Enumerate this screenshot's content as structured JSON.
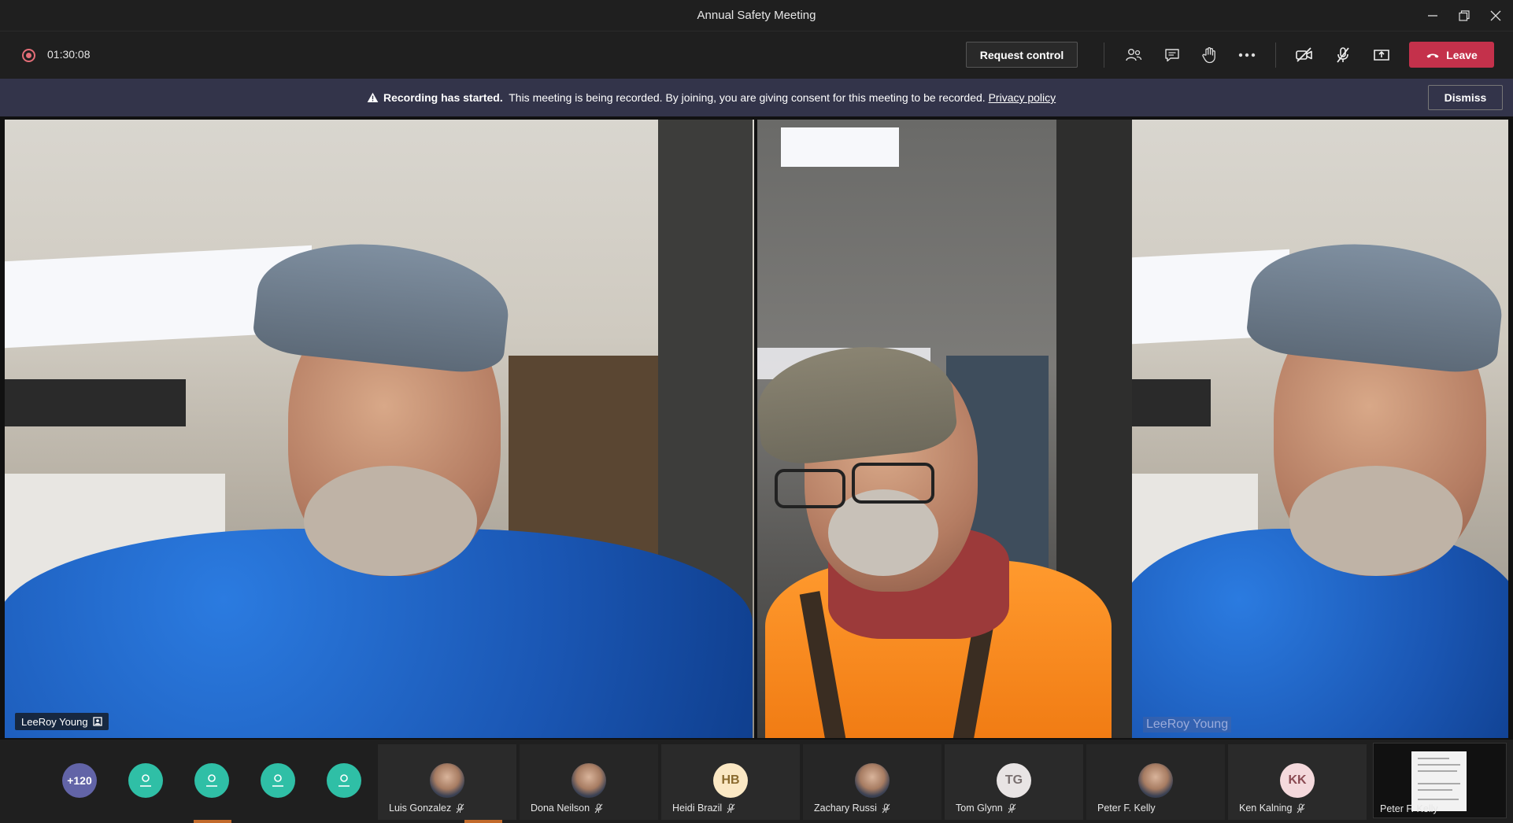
{
  "window": {
    "title": "Annual Safety Meeting",
    "minimize_icon": "minimize-icon",
    "restore_icon": "restore-icon",
    "close_icon": "close-icon"
  },
  "toolbar": {
    "recording_icon": "recording-dot-icon",
    "elapsed_time": "01:30:08",
    "request_control_label": "Request control",
    "icons": [
      "people-icon",
      "chat-icon",
      "raise-hand-icon",
      "more-options-icon",
      "camera-off-icon",
      "mic-off-icon",
      "share-screen-icon"
    ],
    "leave_label": "Leave",
    "leave_color": "#c4314b"
  },
  "banner": {
    "warning_icon": "warning-icon",
    "bold_text": "Recording has started.",
    "text": "This meeting is being recorded. By joining, you are giving consent for this meeting to be recorded.",
    "link_text": "Privacy policy",
    "dismiss_label": "Dismiss",
    "background": "#33344a"
  },
  "videos": [
    {
      "name": "LeeRoy Young",
      "badge_icon": "pinned-presenter-icon"
    },
    {
      "name": ""
    },
    {
      "overlay_name": "LeeRoy Young"
    }
  ],
  "participants": {
    "overflow_count": "+120",
    "anonymous_count": 4,
    "tiles": [
      {
        "name": "Luis Gonzalez",
        "avatar": "photo",
        "muted": true
      },
      {
        "name": "Dona Neilson",
        "avatar": "photo",
        "muted": true
      },
      {
        "name": "Heidi Brazil",
        "initials": "HB",
        "muted": true
      },
      {
        "name": "Zachary Russi",
        "avatar": "photo",
        "muted": true
      },
      {
        "name": "Tom Glynn",
        "initials": "TG",
        "muted": true
      },
      {
        "name": "Peter F. Kelly",
        "avatar": "photo",
        "muted": false
      },
      {
        "name": "Ken Kalning",
        "initials": "KK",
        "muted": true
      }
    ],
    "shared_screen_label": "Peter F. Kelly"
  }
}
